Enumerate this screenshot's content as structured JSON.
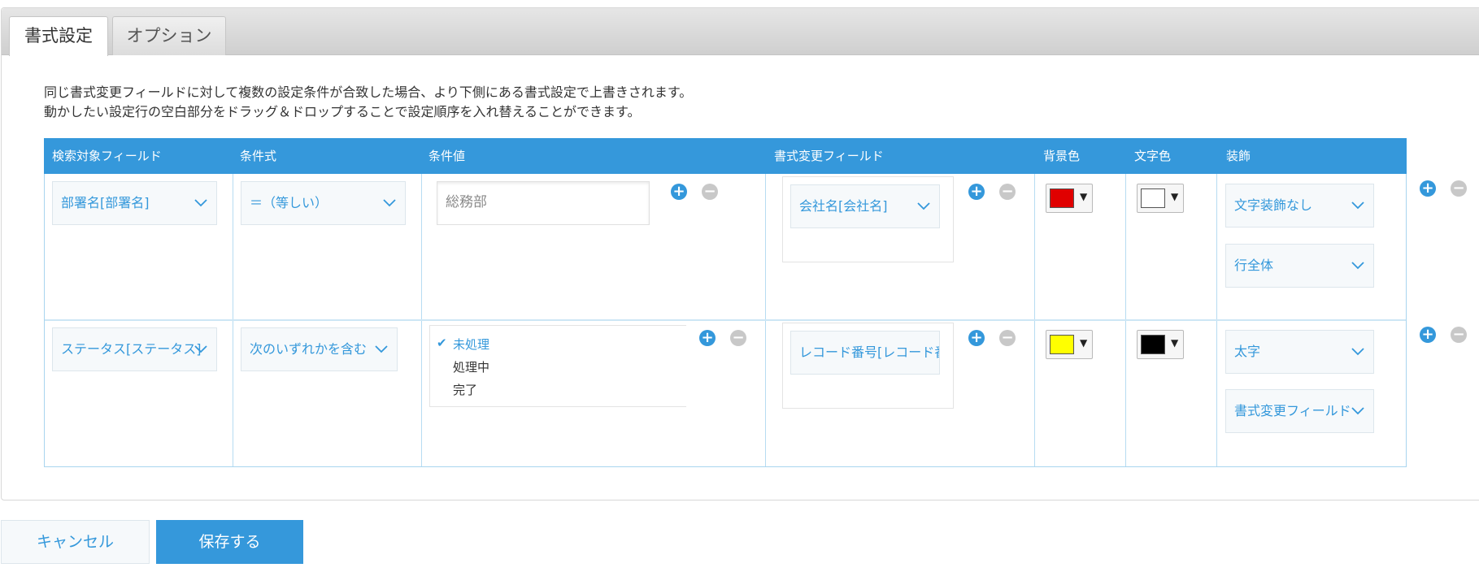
{
  "tabs": [
    "書式設定",
    "オプション"
  ],
  "description": [
    "同じ書式変更フィールドに対して複数の設定条件が合致した場合、より下側にある書式設定で上書きされます。",
    "動かしたい設定行の空白部分をドラッグ＆ドロップすることで設定順序を入れ替えることができます。"
  ],
  "headers": {
    "search_field": "検索対象フィールド",
    "condition": "条件式",
    "condition_value": "条件値",
    "target_field": "書式変更フィールド",
    "bg_color": "背景色",
    "text_color": "文字色",
    "decoration": "装飾"
  },
  "rows": [
    {
      "search_field": "部署名[部署名]",
      "condition": "＝（等しい）",
      "value_input": "総務部",
      "target_field": "会社名[会社名]",
      "bg_color": "#e00000",
      "text_color": "#ffffff",
      "decoration_style": "文字装飾なし",
      "decoration_scope": "行全体"
    },
    {
      "search_field": "ステータス[ステータス]",
      "condition": "次のいずれかを含む",
      "value_options": [
        {
          "label": "未処理",
          "checked": true
        },
        {
          "label": "処理中",
          "checked": false
        },
        {
          "label": "完了",
          "checked": false
        }
      ],
      "target_field": "レコード番号[レコード番号]",
      "bg_color": "#ffff00",
      "text_color": "#000000",
      "decoration_style": "太字",
      "decoration_scope": "書式変更フィールド"
    }
  ],
  "buttons": {
    "cancel": "キャンセル",
    "save": "保存する",
    "add": "+",
    "remove": "−"
  },
  "colors": {
    "accent": "#3598db",
    "remove_gray": "#c8c8c8"
  }
}
